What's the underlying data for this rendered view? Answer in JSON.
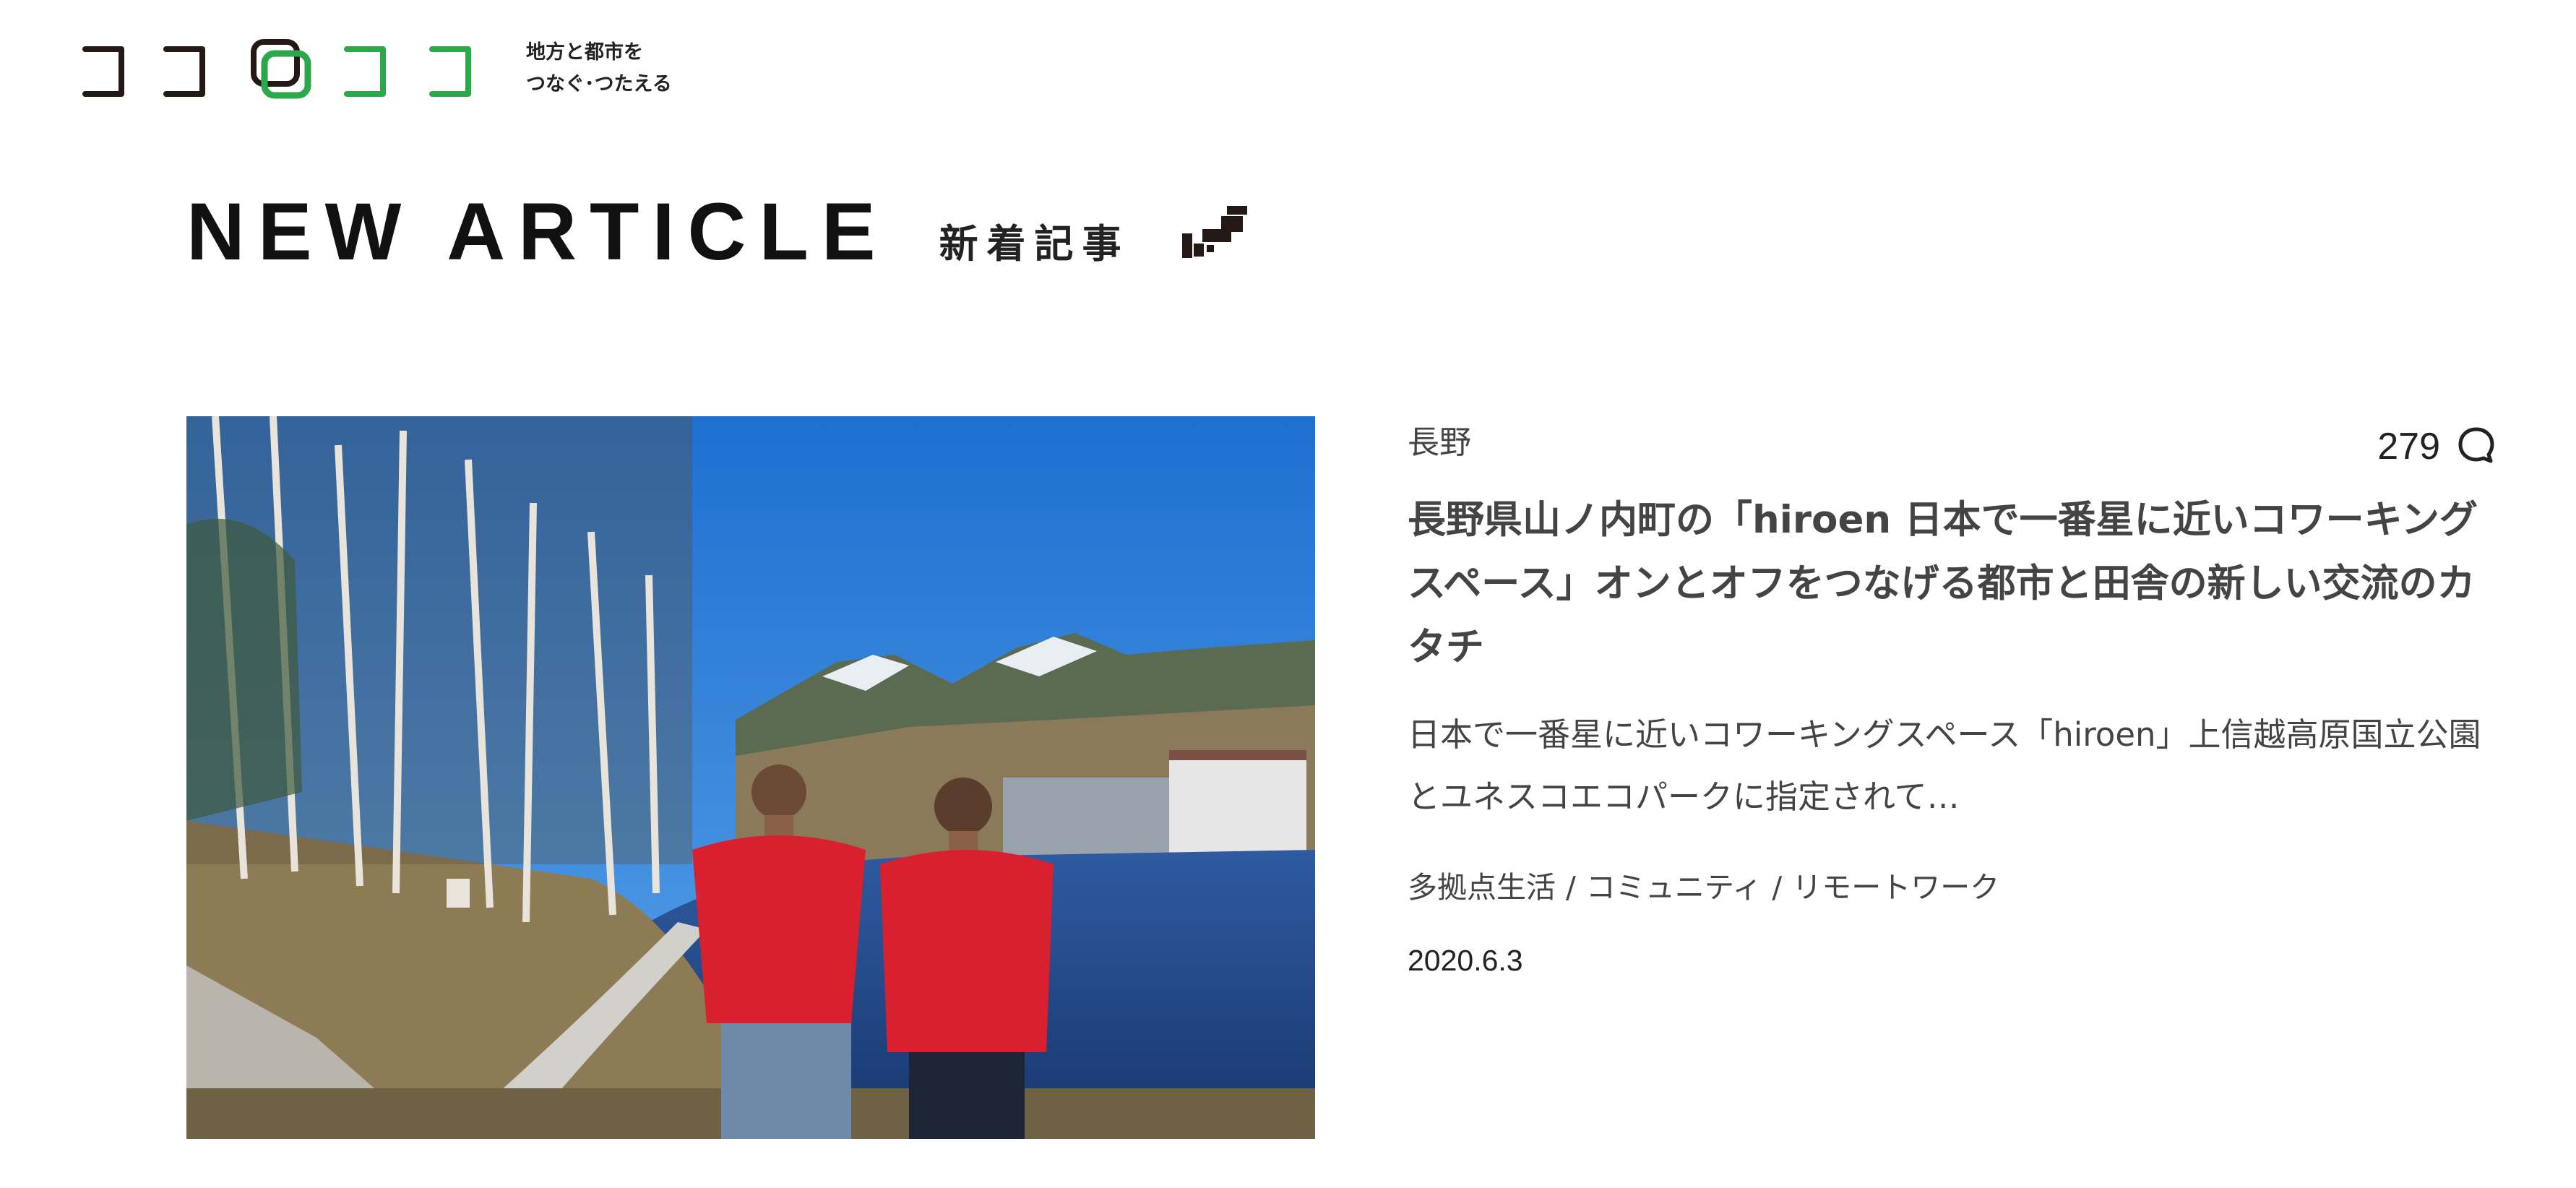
{
  "header": {
    "logo_name": "cocooco-logo",
    "tagline_line1": "地方と都市を",
    "tagline_line2": "つなぐ･つたえる"
  },
  "section": {
    "title": "NEW ARTICLE",
    "subtitle": "新着記事",
    "icon": "japan-map-icon"
  },
  "article": {
    "region": "長野",
    "comment_count": "279",
    "comment_icon": "speech-bubble-icon",
    "title": "長野県山ノ内町の「hiroen 日本で一番星に近いコワーキングスペース」オンとオフをつなげる都市と田舎の新しい交流のカタチ",
    "excerpt": "日本で一番星に近いコワーキングスペース「hiroen」上信越高原国立公園とユネスコエコパークに指定されて…",
    "tags": [
      "多拠点生活",
      "コミュニティ",
      "リモートワーク"
    ],
    "date": "2020.6.3"
  },
  "colors": {
    "logo_dark": "#231815",
    "logo_green": "#2aa84a",
    "sky": "#2f7fd6",
    "jacket": "#d9202f"
  }
}
